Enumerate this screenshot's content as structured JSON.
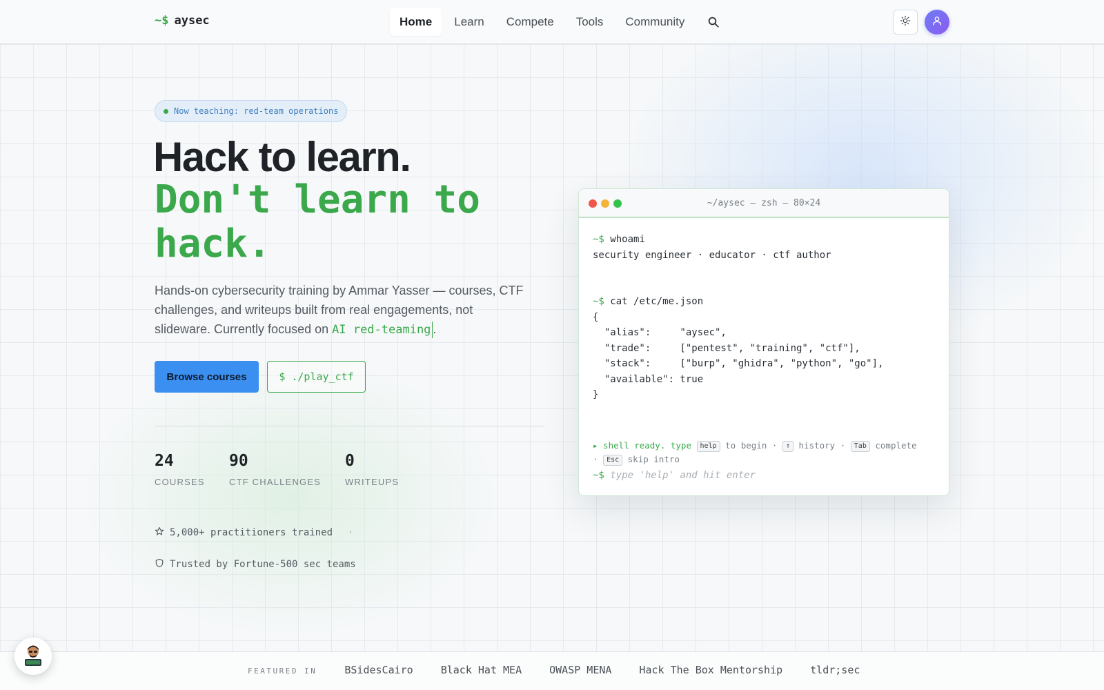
{
  "brand": {
    "prompt": "~$",
    "name": "aysec"
  },
  "nav": {
    "items": [
      {
        "label": "Home",
        "active": true
      },
      {
        "label": "Learn"
      },
      {
        "label": "Compete"
      },
      {
        "label": "Tools"
      },
      {
        "label": "Community"
      }
    ],
    "search_icon": "search-icon"
  },
  "header_actions": {
    "theme_icon": "sun-icon",
    "account_icon": "user-icon"
  },
  "hero": {
    "badge": "Now teaching: red-team operations",
    "title_line1": "Hack to learn.",
    "title_line2": "Don't learn to hack.",
    "lede_prefix": "Hands-on cybersecurity training by Ammar Yasser — courses, CTF challenges, and writeups built from real engagements, not slideware. Currently focused on ",
    "lede_highlight": "AI red-teaming",
    "lede_suffix": ".",
    "primary_button": "Browse courses",
    "secondary_button": "$ ./play_ctf"
  },
  "stats": [
    {
      "value": "24",
      "label": "COURSES"
    },
    {
      "value": "90",
      "label": "CTF CHALLENGES"
    },
    {
      "value": "0",
      "label": "WRITEUPS"
    }
  ],
  "trust": [
    {
      "icon": "star-icon",
      "text": "5,000+ practitioners trained",
      "sep": "·"
    },
    {
      "icon": "shield-icon",
      "text": "Trusted by Fortune-500 sec teams"
    }
  ],
  "terminal": {
    "title": "~/aysec — zsh — 80×24",
    "prompt": "~$",
    "cmd1": "whoami",
    "out1": "security engineer · educator · ctf author",
    "cmd2": "cat /etc/me.json",
    "json_lines": [
      "{",
      "  \"alias\":     \"aysec\",",
      "  \"trade\":     [\"pentest\", \"training\", \"ctf\"],",
      "  \"stack\":     [\"burp\", \"ghidra\", \"python\", \"go\"],",
      "  \"available\": true",
      "}"
    ],
    "hint": {
      "lead": "▸ shell ready. type",
      "k_help": "help",
      "t1": "to begin ·",
      "k_up": "↑",
      "t2": "history ·",
      "k_tab": "Tab",
      "t3": "complete",
      "t4": "·",
      "k_esc": "Esc",
      "t5": "skip intro"
    },
    "input_placeholder": "type 'help' and hit enter"
  },
  "featured": {
    "label": "FEATURED IN",
    "items": [
      "BSidesCairo",
      "Black Hat MEA",
      "OWASP MENA",
      "Hack The Box Mentorship",
      "tldr;sec"
    ]
  },
  "chat": {
    "icon": "hacker-avatar-icon"
  },
  "colors": {
    "accent_green": "#3aa84b",
    "accent_blue": "#3b8ff0",
    "avatar_purple": "#7b6ef2"
  }
}
